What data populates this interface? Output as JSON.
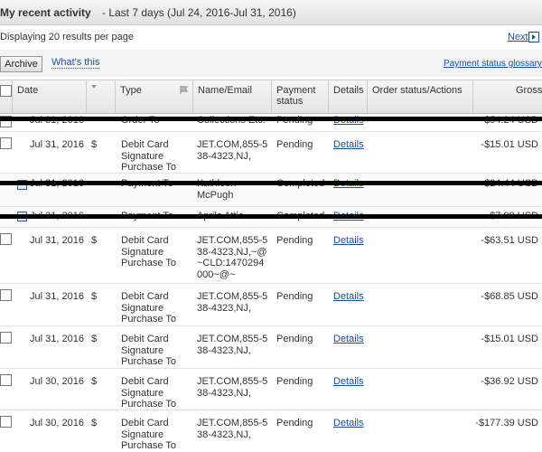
{
  "header": {
    "title": "My recent activity",
    "range": "- Last 7 days (Jul 24, 2016-Jul 31, 2016)"
  },
  "pager": {
    "displaying": "Displaying 20 results per page",
    "next": "Next"
  },
  "toolbar": {
    "archive": "Archive",
    "whats_this": "What's this",
    "glossary": "Payment status glossary"
  },
  "columns": {
    "date": "Date",
    "type": "Type",
    "name_email": "Name/Email",
    "payment_status": "Payment status",
    "details": "Details",
    "order_status": "Order status/Actions",
    "gross": "Gross"
  },
  "rows": [
    {
      "date": "Jul 31, 2016",
      "currency": "",
      "type": "Order To",
      "name": "Collections Etc.",
      "status": "Pending",
      "details": "Details",
      "gross": "-$54.24 USD",
      "struck": true
    },
    {
      "date": "Jul 31, 2016",
      "currency": "$",
      "type": "Debit Card Signature Purchase To",
      "name": "JET.COM,855-5 38-4323,NJ,",
      "status": "Pending",
      "details": "Details",
      "gross": "-$15.01 USD",
      "struck": false
    },
    {
      "date": "Jul 31, 2016",
      "currency": "",
      "type": "Payment To",
      "name": "Kathleen McPugh",
      "status": "Completed",
      "details": "Details",
      "gross": "-$24.44 USD",
      "struck": true
    },
    {
      "date": "Jul 31, 2016",
      "currency": "",
      "type": "Payment To",
      "name": "Aprils Attic",
      "status": "Completed",
      "details": "Details",
      "gross": "-$7.99 USD",
      "struck": true
    },
    {
      "date": "Jul 31, 2016",
      "currency": "$",
      "type": "Debit Card Signature Purchase To",
      "name": "JET.COM,855-5 38-4323,NJ,~@ ~CLD:1470294 000~@~",
      "status": "Pending",
      "details": "Details",
      "gross": "-$63.51 USD",
      "struck": false
    },
    {
      "date": "Jul 31, 2016",
      "currency": "$",
      "type": "Debit Card Signature Purchase To",
      "name": "JET.COM,855-5 38-4323,NJ,",
      "status": "Pending",
      "details": "Details",
      "gross": "-$68.85 USD",
      "struck": false
    },
    {
      "date": "Jul 31, 2016",
      "currency": "$",
      "type": "Debit Card Signature Purchase To",
      "name": "JET.COM,855-5 38-4323,NJ,",
      "status": "Pending",
      "details": "Details",
      "gross": "-$15.01 USD",
      "struck": false
    },
    {
      "date": "Jul 30, 2016",
      "currency": "$",
      "type": "Debit Card Signature Purchase To",
      "name": "JET.COM,855-5 38-4323,NJ,",
      "status": "Pending",
      "details": "Details",
      "gross": "-$36.92 USD",
      "struck": false
    },
    {
      "date": "Jul 30, 2016",
      "currency": "$",
      "type": "Debit Card Signature Purchase To",
      "name": "JET.COM,855-5 38-4323,NJ,",
      "status": "Pending",
      "details": "Details",
      "gross": "-$177.39 USD",
      "struck": false
    }
  ]
}
